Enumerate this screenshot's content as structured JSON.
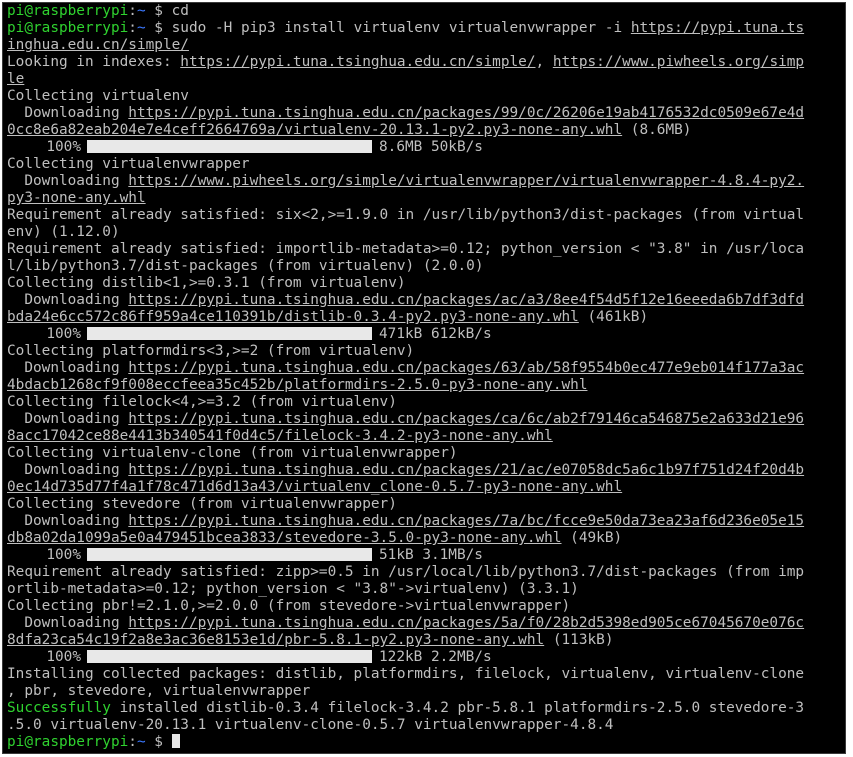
{
  "prompt": {
    "user": "pi@raspberrypi",
    "colon": ":",
    "path": "~",
    "sign": " $ "
  },
  "lines": [
    {
      "type": "prompt",
      "cmd": "cd"
    },
    {
      "type": "prompt",
      "cmd": "sudo -H pip3 install virtualenv virtualenvwrapper -i ",
      "url": "https://pypi.tuna.ts"
    },
    {
      "type": "url",
      "url": "inghua.edu.cn/simple/"
    },
    {
      "type": "text",
      "text": "Looking in indexes: ",
      "url": "https://pypi.tuna.tsinghua.edu.cn/simple/",
      "mid": ", ",
      "url2": "https://www.piwheels.org/simp"
    },
    {
      "type": "url",
      "url": "le"
    },
    {
      "type": "text",
      "text": "Collecting virtualenv"
    },
    {
      "type": "text",
      "text": "  Downloading ",
      "url": "https://pypi.tuna.tsinghua.edu.cn/packages/99/0c/26206e19ab4176532dc0509e67e4d"
    },
    {
      "type": "text",
      "text": "",
      "url": "0cc8e6a82eab204e7e4ceff2664769a/virtualenv-20.13.1-py2.py3-none-any.whl",
      "tail": " (8.6MB)"
    },
    {
      "type": "bar",
      "pct": "100%",
      "info": "8.6MB 50kB/s"
    },
    {
      "type": "text",
      "text": "Collecting virtualenvwrapper"
    },
    {
      "type": "text",
      "text": "  Downloading ",
      "url": "https://www.piwheels.org/simple/virtualenvwrapper/virtualenvwrapper-4.8.4-py2."
    },
    {
      "type": "url",
      "url": "py3-none-any.whl"
    },
    {
      "type": "text",
      "text": "Requirement already satisfied: six<2,>=1.9.0 in /usr/lib/python3/dist-packages (from virtual"
    },
    {
      "type": "text",
      "text": "env) (1.12.0)"
    },
    {
      "type": "text",
      "text": "Requirement already satisfied: importlib-metadata>=0.12; python_version < \"3.8\" in /usr/loca"
    },
    {
      "type": "text",
      "text": "l/lib/python3.7/dist-packages (from virtualenv) (2.0.0)"
    },
    {
      "type": "text",
      "text": "Collecting distlib<1,>=0.3.1 (from virtualenv)"
    },
    {
      "type": "text",
      "text": "  Downloading ",
      "url": "https://pypi.tuna.tsinghua.edu.cn/packages/ac/a3/8ee4f54d5f12e16eeeda6b7df3dfd"
    },
    {
      "type": "text",
      "text": "",
      "url": "bda24e6cc572c86ff959a4ce110391b/distlib-0.3.4-py2.py3-none-any.whl",
      "tail": " (461kB)"
    },
    {
      "type": "bar",
      "pct": "100%",
      "info": "471kB 612kB/s"
    },
    {
      "type": "text",
      "text": "Collecting platformdirs<3,>=2 (from virtualenv)"
    },
    {
      "type": "text",
      "text": "  Downloading ",
      "url": "https://pypi.tuna.tsinghua.edu.cn/packages/63/ab/58f9554b0ec477e9eb014f177a3ac"
    },
    {
      "type": "url",
      "url": "4bdacb1268cf9f008eccfeea35c452b/platformdirs-2.5.0-py3-none-any.whl"
    },
    {
      "type": "text",
      "text": "Collecting filelock<4,>=3.2 (from virtualenv)"
    },
    {
      "type": "text",
      "text": "  Downloading ",
      "url": "https://pypi.tuna.tsinghua.edu.cn/packages/ca/6c/ab2f79146ca546875e2a633d21e96"
    },
    {
      "type": "url",
      "url": "8acc17042ce88e4413b340541f0d4c5/filelock-3.4.2-py3-none-any.whl"
    },
    {
      "type": "text",
      "text": "Collecting virtualenv-clone (from virtualenvwrapper)"
    },
    {
      "type": "text",
      "text": "  Downloading ",
      "url": "https://pypi.tuna.tsinghua.edu.cn/packages/21/ac/e07058dc5a6c1b97f751d24f20d4b"
    },
    {
      "type": "url",
      "url": "0ec14d735d77f4a1f78c471d6d13a43/virtualenv_clone-0.5.7-py3-none-any.whl"
    },
    {
      "type": "text",
      "text": "Collecting stevedore (from virtualenvwrapper)"
    },
    {
      "type": "text",
      "text": "  Downloading ",
      "url": "https://pypi.tuna.tsinghua.edu.cn/packages/7a/bc/fcce9e50da73ea23af6d236e05e15"
    },
    {
      "type": "text",
      "text": "",
      "url": "db8a02da1099a5e0a479451bcea3833/stevedore-3.5.0-py3-none-any.whl",
      "tail": " (49kB)"
    },
    {
      "type": "bar",
      "pct": "100%",
      "info": "51kB 3.1MB/s"
    },
    {
      "type": "text",
      "text": "Requirement already satisfied: zipp>=0.5 in /usr/local/lib/python3.7/dist-packages (from imp"
    },
    {
      "type": "text",
      "text": "ortlib-metadata>=0.12; python_version < \"3.8\"->virtualenv) (3.3.1)"
    },
    {
      "type": "text",
      "text": "Collecting pbr!=2.1.0,>=2.0.0 (from stevedore->virtualenvwrapper)"
    },
    {
      "type": "text",
      "text": "  Downloading ",
      "url": "https://pypi.tuna.tsinghua.edu.cn/packages/5a/f0/28b2d5398ed905ce67045670e076c"
    },
    {
      "type": "text",
      "text": "",
      "url": "8dfa23ca54c19f2a8e3ac36e8153e1d/pbr-5.8.1-py2.py3-none-any.whl",
      "tail": " (113kB)"
    },
    {
      "type": "bar",
      "pct": "100%",
      "info": "122kB 2.2MB/s"
    },
    {
      "type": "text",
      "text": "Installing collected packages: distlib, platformdirs, filelock, virtualenv, virtualenv-clone"
    },
    {
      "type": "text",
      "text": ", pbr, stevedore, virtualenvwrapper"
    },
    {
      "type": "success",
      "word": "Successfully",
      "text": " installed distlib-0.3.4 filelock-3.4.2 pbr-5.8.1 platformdirs-2.5.0 stevedore-3"
    },
    {
      "type": "text",
      "text": ".5.0 virtualenv-20.13.1 virtualenv-clone-0.5.7 virtualenvwrapper-4.8.4"
    },
    {
      "type": "prompt",
      "cmd": "",
      "cursor": true
    }
  ]
}
